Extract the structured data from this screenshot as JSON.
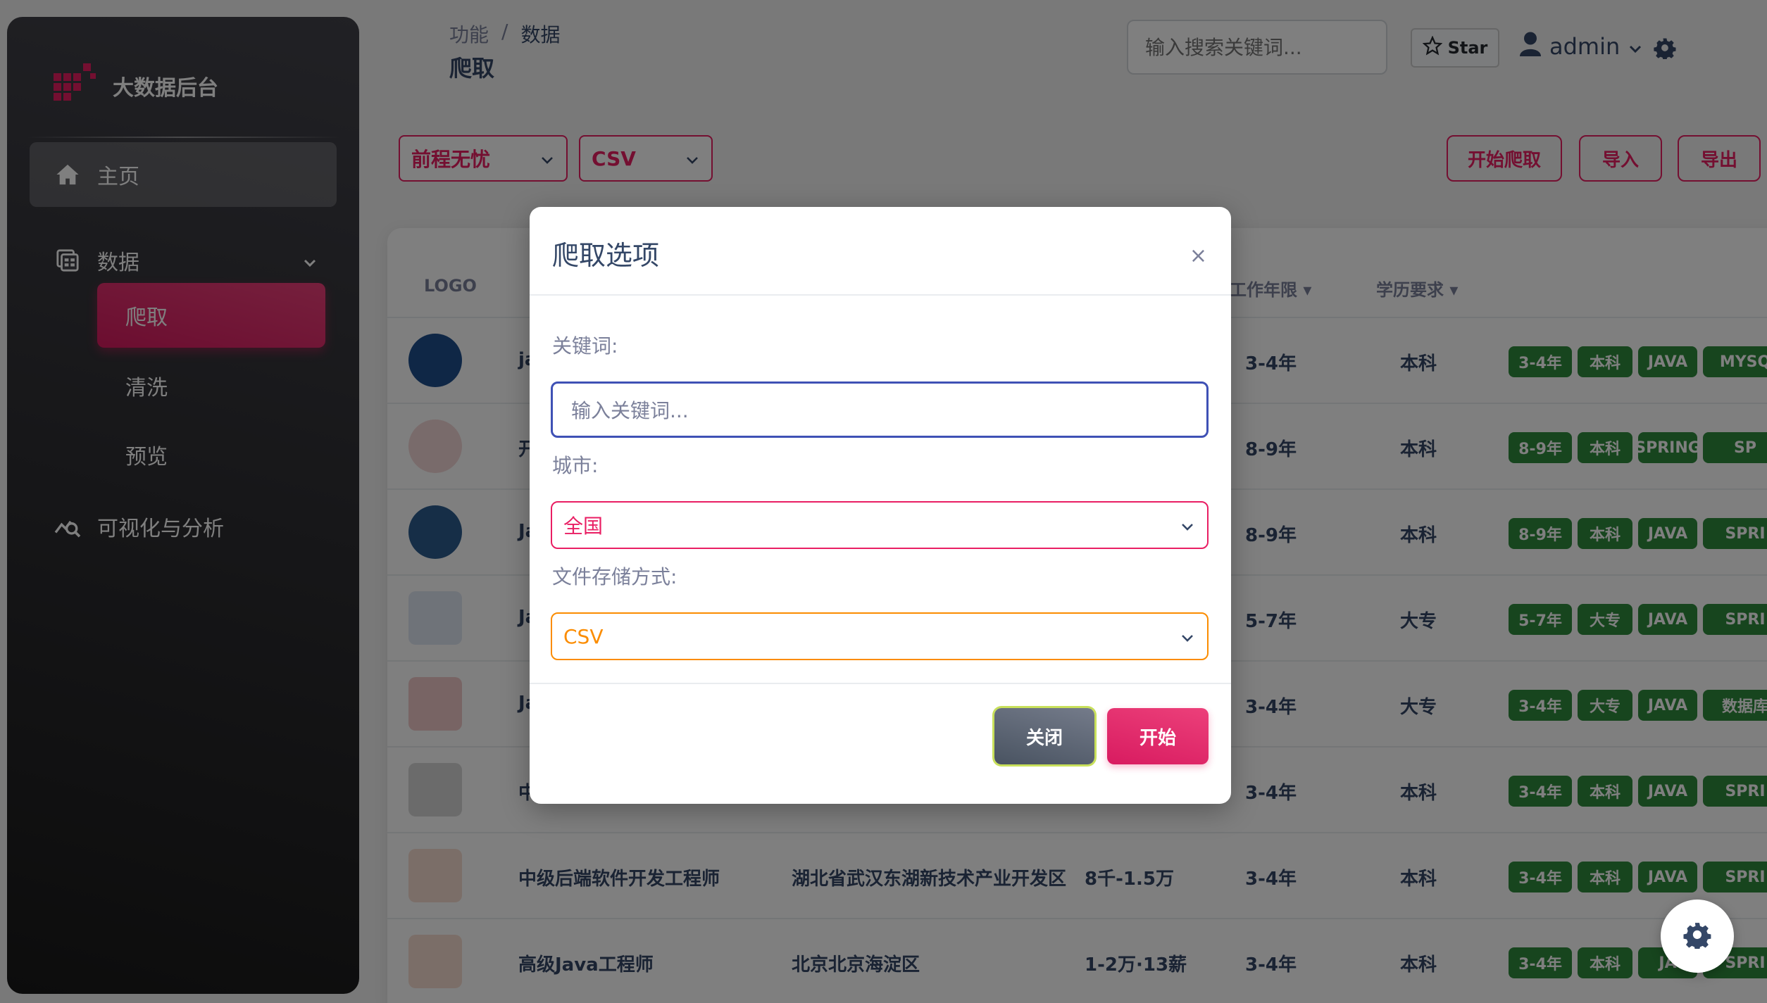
{
  "app": {
    "brand": "大数据后台"
  },
  "sidebar": {
    "items": [
      {
        "label": "主页",
        "icon": "home-icon"
      },
      {
        "label": "数据",
        "icon": "dataset-icon"
      },
      {
        "label": "可视化与分析",
        "icon": "query-stats-icon"
      }
    ],
    "sub_items": [
      {
        "label": "爬取",
        "active": true
      },
      {
        "label": "清洗"
      },
      {
        "label": "预览"
      }
    ]
  },
  "header": {
    "breadcrumb": [
      "功能",
      "/",
      "数据"
    ],
    "title": "爬取",
    "search_placeholder": "输入搜索关键词...",
    "star_label": "Star",
    "user": "admin"
  },
  "filters": {
    "site": "前程无忧",
    "format": "CSV",
    "actions": [
      "开始爬取",
      "导入",
      "导出"
    ]
  },
  "table": {
    "headers": [
      "LOGO",
      "工作年限",
      "学历要求"
    ],
    "rows": [
      {
        "title": "ja",
        "location": "",
        "salary": "",
        "exp": "3-4年",
        "edu": "本科",
        "tags": [
          "3-4年",
          "本科",
          "JAVA",
          "MYSQ"
        ]
      },
      {
        "title": "开",
        "location": "",
        "salary": "",
        "exp": "8-9年",
        "edu": "本科",
        "tags": [
          "8-9年",
          "本科",
          "SPRING",
          "SP"
        ]
      },
      {
        "title": "Ja",
        "location": "",
        "salary": "",
        "exp": "8-9年",
        "edu": "本科",
        "tags": [
          "8-9年",
          "本科",
          "JAVA",
          "SPRI"
        ]
      },
      {
        "title": "Ja",
        "location": "",
        "salary": "",
        "exp": "5-7年",
        "edu": "大专",
        "tags": [
          "5-7年",
          "大专",
          "JAVA",
          "SPRI"
        ]
      },
      {
        "title": "Ja",
        "location": "",
        "salary": "",
        "exp": "3-4年",
        "edu": "大专",
        "tags": [
          "3-4年",
          "大专",
          "JAVA",
          "数据库"
        ]
      },
      {
        "title": "中",
        "location": "",
        "salary": "",
        "exp": "3-4年",
        "edu": "本科",
        "tags": [
          "3-4年",
          "本科",
          "JAVA",
          "SPRI"
        ]
      },
      {
        "title": "中级后端软件开发工程师",
        "location": "湖北省武汉东湖新技术产业开发区",
        "salary": "8千-1.5万",
        "exp": "3-4年",
        "edu": "本科",
        "tags": [
          "3-4年",
          "本科",
          "JAVA",
          "SPRI"
        ]
      },
      {
        "title": "高级Java工程师",
        "location": "北京北京海淀区",
        "salary": "1-2万·13薪",
        "exp": "3-4年",
        "edu": "本科",
        "tags": [
          "3-4年",
          "本科",
          "JA",
          "SPRI"
        ]
      }
    ]
  },
  "modal": {
    "title": "爬取选项",
    "close_symbol": "×",
    "keyword_label": "关键词:",
    "keyword_placeholder": "输入关键词...",
    "city_label": "城市:",
    "city_value": "全国",
    "storage_label": "文件存储方式:",
    "storage_value": "CSV",
    "close_button": "关闭",
    "start_button": "开始"
  },
  "colors": {
    "accent": "#e91e63",
    "badge": "#2e8b3d",
    "sidebar": "#2a2a2f"
  }
}
